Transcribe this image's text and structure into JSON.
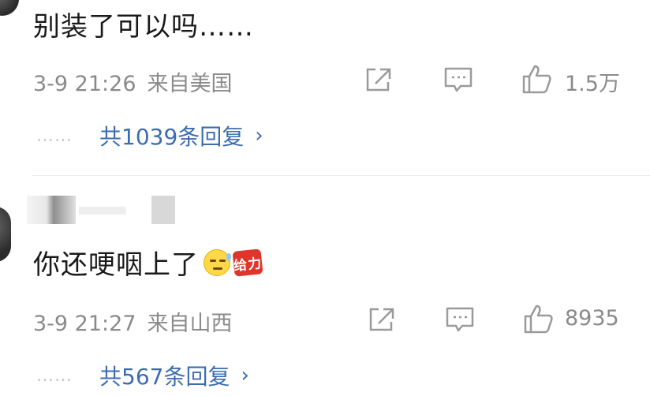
{
  "colors": {
    "text": "#1a1a1a",
    "meta": "#8a8a8a",
    "link": "#3d6cb0",
    "icon": "#9a9a9a"
  },
  "comments": [
    {
      "text": "别装了可以吗……",
      "time": "3-9 21:26",
      "location": "来自美国",
      "likes": "1.5万",
      "replies_dots": "……",
      "replies_label": "共1039条回复",
      "chevron": "›"
    },
    {
      "text": "你还哽咽上了",
      "emoji": "sweat-face-icon",
      "sticker_text": "给力",
      "time": "3-9 21:27",
      "location": "来自山西",
      "likes": "8935",
      "replies_dots": "……",
      "replies_label": "共567条回复",
      "chevron": "›"
    }
  ],
  "icons": {
    "share": "share-icon",
    "comment": "comment-icon",
    "like": "thumbs-up-icon"
  }
}
